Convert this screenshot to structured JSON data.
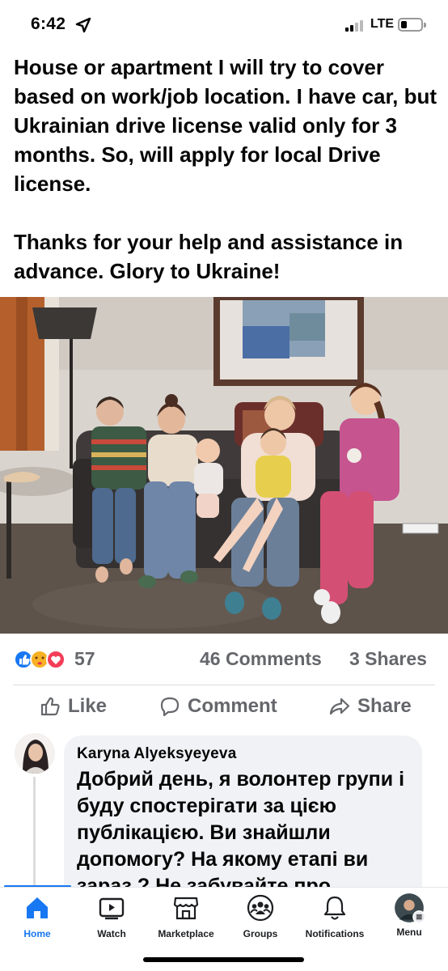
{
  "status_bar": {
    "time": "6:42",
    "network": "LTE"
  },
  "post": {
    "paragraphs": [
      "House or apartment I will try to cover based on work/job location. I have car, but Ukrainian drive license valid only for 3 months. So, will apply for local Drive license.",
      "Thanks for your help and assistance in advance. Glory to Ukraine!"
    ]
  },
  "photo": {
    "tv_text": ""
  },
  "reactions": {
    "count": "57",
    "comments": "46 Comments",
    "shares": "3 Shares",
    "icons": [
      "like-icon",
      "care-icon",
      "love-icon"
    ]
  },
  "actions": {
    "like": "Like",
    "comment": "Comment",
    "share": "Share"
  },
  "comment": {
    "author": "Karyna Alyeksyeyeva",
    "text": "Добрий день, я волонтер групи і буду спостерігати за цією публікацією. Ви знайшли допомогу? На якому етапі ви зараз ? Не забувайте про"
  },
  "tabs": [
    {
      "label": "Home",
      "icon": "home-icon",
      "active": true
    },
    {
      "label": "Watch",
      "icon": "watch-icon"
    },
    {
      "label": "Marketplace",
      "icon": "marketplace-icon"
    },
    {
      "label": "Groups",
      "icon": "groups-icon"
    },
    {
      "label": "Notifications",
      "icon": "bell-icon"
    },
    {
      "label": "Menu",
      "icon": "menu-avatar-icon"
    }
  ],
  "colors": {
    "accent": "#1877f2",
    "secondary_text": "#65676b",
    "bubble": "#f0f2f5"
  }
}
